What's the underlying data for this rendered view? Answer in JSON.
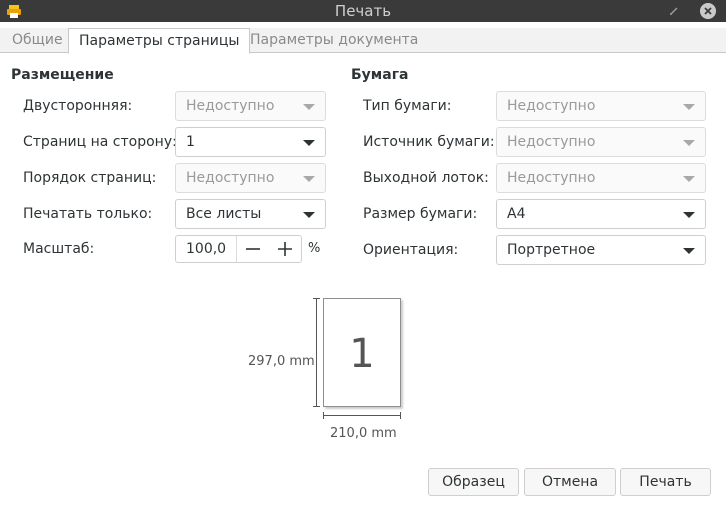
{
  "window": {
    "title": "Печать",
    "app_icon": "printer-app-icon",
    "title_buttons": [
      "minimize-icon",
      "close-icon"
    ]
  },
  "tabs": [
    {
      "label": "Общие",
      "active": false
    },
    {
      "label": "Параметры страницы",
      "active": true
    },
    {
      "label": "Параметры документа",
      "active": false
    }
  ],
  "layout_section": {
    "title": "Размещение",
    "two_sided": {
      "label": "Двусторонняя:",
      "value": "Недоступно",
      "enabled": false
    },
    "pages_per_side": {
      "label": "Страниц на сторону:",
      "value": "1",
      "enabled": true
    },
    "page_order": {
      "label": "Порядок страниц:",
      "value": "Недоступно",
      "enabled": false
    },
    "only_print": {
      "label": "Печатать только:",
      "value": "Все листы",
      "enabled": true
    },
    "scale": {
      "label": "Масштаб:",
      "value": "100,0",
      "unit": "%"
    }
  },
  "paper_section": {
    "title": "Бумага",
    "paper_type": {
      "label": "Тип бумаги:",
      "value": "Недоступно",
      "enabled": false
    },
    "paper_source": {
      "label": "Источник бумаги:",
      "value": "Недоступно",
      "enabled": false
    },
    "output_tray": {
      "label": "Выходной лоток:",
      "value": "Недоступно",
      "enabled": false
    },
    "paper_size": {
      "label": "Размер бумаги:",
      "value": "A4",
      "enabled": true
    },
    "orientation": {
      "label": "Ориентация:",
      "value": "Портретное",
      "enabled": true
    }
  },
  "preview": {
    "page_number": "1",
    "height_label": "297,0 mm",
    "width_label": "210,0 mm"
  },
  "buttons": {
    "preview": "Образец",
    "cancel": "Отмена",
    "print": "Печать"
  },
  "colors": {
    "titlebar": "#3a3a3a",
    "background": "#ffffff",
    "disabled_text": "#9a9a9a"
  }
}
